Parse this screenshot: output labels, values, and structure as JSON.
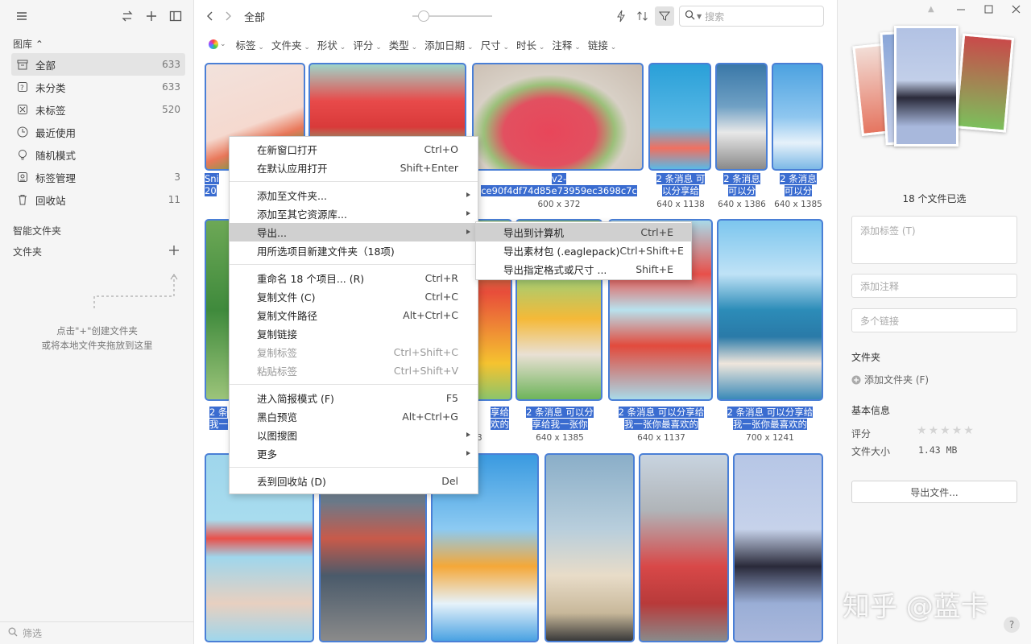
{
  "sidebar": {
    "library_label": "图库 ⌃",
    "items": [
      {
        "label": "全部",
        "count": "633",
        "icon": "archive-icon"
      },
      {
        "label": "未分类",
        "count": "633",
        "icon": "unsorted-icon"
      },
      {
        "label": "未标签",
        "count": "520",
        "icon": "untagged-icon"
      },
      {
        "label": "最近使用",
        "count": "",
        "icon": "clock-icon"
      },
      {
        "label": "随机模式",
        "count": "",
        "icon": "bulb-icon"
      },
      {
        "label": "标签管理",
        "count": "3",
        "icon": "tag-icon"
      },
      {
        "label": "回收站",
        "count": "11",
        "icon": "trash-icon"
      }
    ],
    "smart_folder": "智能文件夹",
    "folders": "文件夹",
    "hint_line1": "点击\"+\"创建文件夹",
    "hint_line2": "或将本地文件夹拖放到这里",
    "filter_placeholder": "筛选"
  },
  "topbar": {
    "title": "全部",
    "search_placeholder": "搜索"
  },
  "filters": [
    "标签",
    "文件夹",
    "形状",
    "评分",
    "类型",
    "添加日期",
    "尺寸",
    "时长",
    "注释",
    "链接"
  ],
  "grid": [
    {
      "line1": "Sni",
      "line2": "20",
      "dims": ""
    },
    {
      "line1": "",
      "line2": "",
      "dims": ""
    },
    {
      "line1": "v2-",
      "line2": "ce90f4df74d85e73959ec3698c7c",
      "dims": "600 x 372"
    },
    {
      "line1": "2 条消息 可",
      "line2": "以分享给",
      "dims": "640 x 1138"
    },
    {
      "line1": "2 条消息",
      "line2": "可以分",
      "dims": "640 x 1386"
    },
    {
      "line1": "2 条消息",
      "line2": "可以分",
      "dims": "640 x 1385"
    },
    {
      "line1": "2 条",
      "line2": "我一",
      "dims": ""
    },
    {
      "line1": "享给",
      "line2": "欢的",
      "dims": "3"
    },
    {
      "line1": "2 条消息 可以分",
      "line2": "享给我一张你",
      "dims": "640 x 1385"
    },
    {
      "line1": "2 条消息 可以分享给",
      "line2": "我一张你最喜欢的",
      "dims": "640 x 1137"
    },
    {
      "line1": "2 条消息 可以分享给",
      "line2": "我一张你最喜欢的",
      "dims": "700 x 1241"
    }
  ],
  "context_menu": [
    {
      "label": "在新窗口打开",
      "key": "Ctrl+O"
    },
    {
      "label": "在默认应用打开",
      "key": "Shift+Enter"
    },
    {
      "sep": true
    },
    {
      "label": "添加至文件夹...",
      "key": "",
      "sub": true
    },
    {
      "label": "添加至其它资源库...",
      "key": "",
      "sub": true
    },
    {
      "label": "导出...",
      "key": "",
      "sub": true,
      "hover": true
    },
    {
      "label": "用所选项目新建文件夹（18项)",
      "key": ""
    },
    {
      "sep": true
    },
    {
      "label": "重命名 18 个项目... (R)",
      "key": "Ctrl+R"
    },
    {
      "label": "复制文件 (C)",
      "key": "Ctrl+C"
    },
    {
      "label": "复制文件路径",
      "key": "Alt+Ctrl+C"
    },
    {
      "label": "复制链接",
      "key": ""
    },
    {
      "label": "复制标签",
      "key": "Ctrl+Shift+C",
      "disabled": true
    },
    {
      "label": "粘贴标签",
      "key": "Ctrl+Shift+V",
      "disabled": true
    },
    {
      "sep": true
    },
    {
      "label": "进入简报模式 (F)",
      "key": "F5"
    },
    {
      "label": "黑白预览",
      "key": "Alt+Ctrl+G"
    },
    {
      "label": "以图搜图",
      "key": "",
      "sub": true
    },
    {
      "label": "更多",
      "key": "",
      "sub": true
    },
    {
      "sep": true
    },
    {
      "label": "丢到回收站 (D)",
      "key": "Del"
    }
  ],
  "submenu": [
    {
      "label": "导出到计算机",
      "key": "Ctrl+E",
      "hover": true
    },
    {
      "label": "导出素材包 (.eaglepack)",
      "key": "Ctrl+Shift+E"
    },
    {
      "label": "导出指定格式或尺寸 ...",
      "key": "Shift+E"
    }
  ],
  "rpanel": {
    "selected": "18 个文件已选",
    "tag_placeholder": "添加标签 (T)",
    "note_placeholder": "添加注释",
    "link_placeholder": "多个链接",
    "folder_title": "文件夹",
    "add_folder": "添加文件夹 (F)",
    "basic_title": "基本信息",
    "rating_label": "评分",
    "rating_value": 0,
    "size_label": "文件大小",
    "size_value": "1.43 MB",
    "export_btn": "导出文件...",
    "watermark": "知乎 @蓝卡"
  },
  "colors": {
    "accent": "#3a6cd0",
    "border": "#4a7fd6"
  }
}
